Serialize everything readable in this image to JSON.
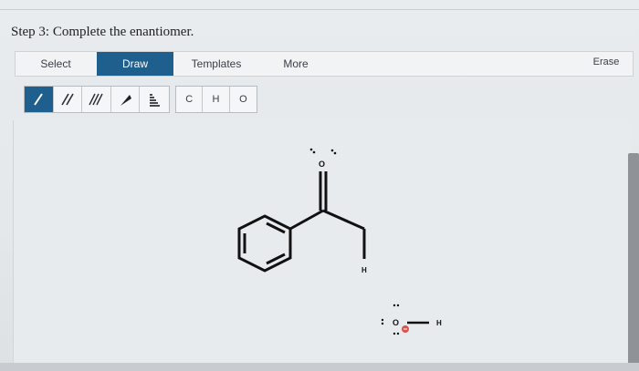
{
  "step": {
    "title": "Step 3: Complete the enantiomer."
  },
  "tabs": {
    "select": "Select",
    "draw": "Draw",
    "templates": "Templates",
    "more": "More",
    "erase": "Erase"
  },
  "bond_tools": [
    {
      "name": "single-bond",
      "label": "/"
    },
    {
      "name": "double-bond",
      "label": "//"
    },
    {
      "name": "triple-bond",
      "label": "///"
    },
    {
      "name": "wedge-bond",
      "label": "▶"
    },
    {
      "name": "hash-bond",
      "label": "hash"
    }
  ],
  "atom_tools": [
    "C",
    "H",
    "O"
  ],
  "molecule": {
    "oxygen_label": "O",
    "hydrogen_label": "H",
    "hydroxyl_oxygen": "O",
    "hydroxyl_hydrogen": "H"
  },
  "colors": {
    "draw_tab": "#1e5f8e",
    "canvas_bg": "#e8ebed",
    "bond": "#111111",
    "negative_charge": "#d9534f"
  }
}
